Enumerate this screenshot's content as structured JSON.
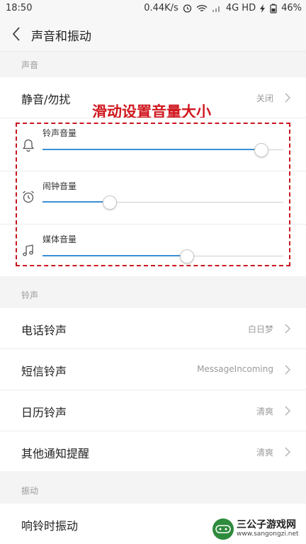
{
  "status_bar": {
    "time": "18:50",
    "speed": "0.44K/s",
    "network": "4G HD",
    "battery": "46%"
  },
  "header": {
    "title": "声音和振动"
  },
  "annotation": {
    "text": "滑动设置音量大小",
    "color": "#d01820"
  },
  "sections": {
    "sound": "声音",
    "ringtone": "铃声",
    "vibration": "振动"
  },
  "silent_row": {
    "label": "静音/勿扰",
    "value": "关闭"
  },
  "volumes": [
    {
      "label": "铃声音量",
      "icon": "bell-icon",
      "level": 0.91
    },
    {
      "label": "闹钟音量",
      "icon": "alarm-clock-icon",
      "level": 0.28
    },
    {
      "label": "媒体音量",
      "icon": "music-note-icon",
      "level": 0.6
    }
  ],
  "ringtone_rows": [
    {
      "label": "电话铃声",
      "value": "白日梦"
    },
    {
      "label": "短信铃声",
      "value": "MessageIncoming"
    },
    {
      "label": "日历铃声",
      "value": "清爽"
    },
    {
      "label": "其他通知提醒",
      "value": "清爽"
    }
  ],
  "vibration_rows": [
    {
      "label": "响铃时振动"
    }
  ],
  "watermark": {
    "name": "三公子游戏网",
    "url": "www.sangongzi.net"
  },
  "colors": {
    "accent": "#3b8fd6",
    "annotation": "#d01820"
  }
}
